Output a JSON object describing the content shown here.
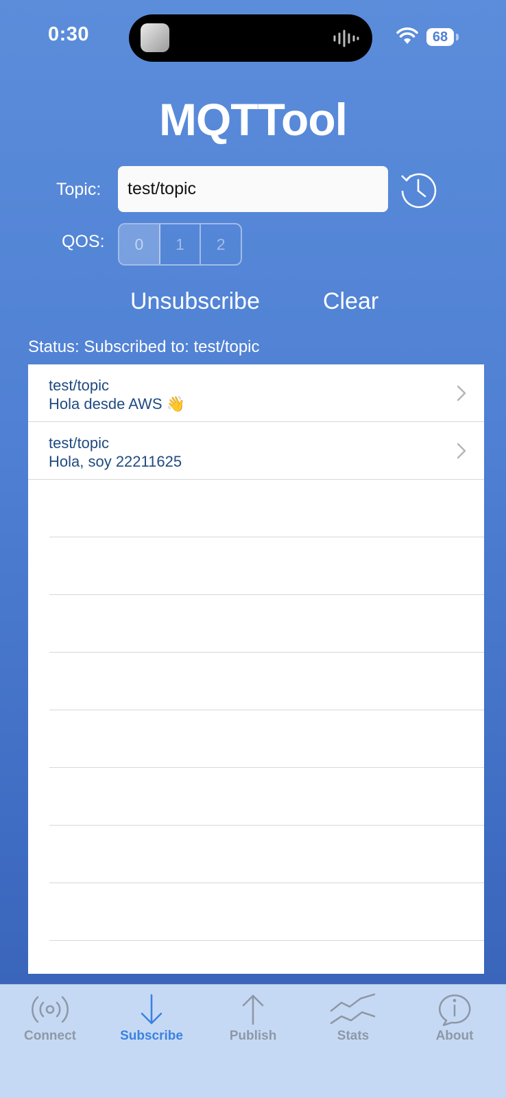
{
  "status_bar": {
    "time": "0:30",
    "battery": "68"
  },
  "app": {
    "title": "MQTTool"
  },
  "subscribe": {
    "topic_label": "Topic:",
    "topic_value": "test/topic",
    "qos_label": "QOS:",
    "qos_options": [
      "0",
      "1",
      "2"
    ],
    "qos_selected": "0",
    "unsubscribe_label": "Unsubscribe",
    "clear_label": "Clear",
    "status_text": "Status: Subscribed to: test/topic"
  },
  "messages": [
    {
      "topic": "test/topic",
      "text": "Hola desde AWS 👋"
    },
    {
      "topic": "test/topic",
      "text": "Hola, soy 22211625"
    }
  ],
  "tabs": [
    {
      "label": "Connect",
      "icon": "broadcast-icon",
      "active": false
    },
    {
      "label": "Subscribe",
      "icon": "arrow-down-icon",
      "active": true
    },
    {
      "label": "Publish",
      "icon": "arrow-up-icon",
      "active": false
    },
    {
      "label": "Stats",
      "icon": "stats-chart-icon",
      "active": false
    },
    {
      "label": "About",
      "icon": "info-bubble-icon",
      "active": false
    }
  ],
  "colors": {
    "background_top": "#5b8ddb",
    "background_bottom": "#365fb4",
    "tab_active": "#3b82e0",
    "tab_inactive": "#8e98a6",
    "message_text": "#1f4a80"
  }
}
